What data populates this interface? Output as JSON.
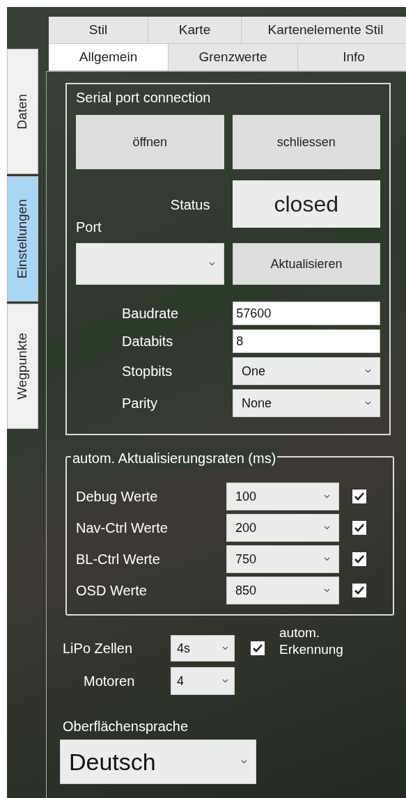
{
  "side_tabs": [
    {
      "label": "Daten",
      "selected": false
    },
    {
      "label": "Einstellungen",
      "selected": true
    },
    {
      "label": "Wegpunkte",
      "selected": false
    }
  ],
  "tabs_row_1": [
    {
      "label": "Stil",
      "selected": false
    },
    {
      "label": "Karte",
      "selected": false
    },
    {
      "label": "Kartenelemente Stil",
      "selected": false
    }
  ],
  "tabs_row_2": [
    {
      "label": "Allgemein",
      "selected": true
    },
    {
      "label": "Grenzwerte",
      "selected": false
    },
    {
      "label": "Info",
      "selected": false
    }
  ],
  "serial": {
    "title": "Serial port connection",
    "open_button": "öffnen",
    "close_button": "schliessen",
    "status_label": "Status",
    "status_value": "closed",
    "port_label": "Port",
    "refresh_button": "Aktualisieren",
    "settings": [
      {
        "label": "Baudrate",
        "kind": "text",
        "value": "57600"
      },
      {
        "label": "Databits",
        "kind": "text",
        "value": "8"
      },
      {
        "label": "Stopbits",
        "kind": "select",
        "value": "One"
      },
      {
        "label": "Parity",
        "kind": "select",
        "value": "None"
      }
    ]
  },
  "rates": {
    "title": "autom. Aktualisierungsraten (ms)",
    "rows": [
      {
        "label": "Debug Werte",
        "value": "100",
        "checked": true
      },
      {
        "label": "Nav-Ctrl Werte",
        "value": "200",
        "checked": true
      },
      {
        "label": "BL-Ctrl Werte",
        "value": "750",
        "checked": true
      },
      {
        "label": "OSD Werte",
        "value": "850",
        "checked": true
      }
    ]
  },
  "lipo": {
    "label": "LiPo Zellen",
    "value": "4s",
    "auto_checked": true,
    "auto_label": "autom. Erkennung"
  },
  "motors": {
    "label": "Motoren",
    "value": "4"
  },
  "language": {
    "label": "Oberflächensprache",
    "value": "Deutsch"
  }
}
